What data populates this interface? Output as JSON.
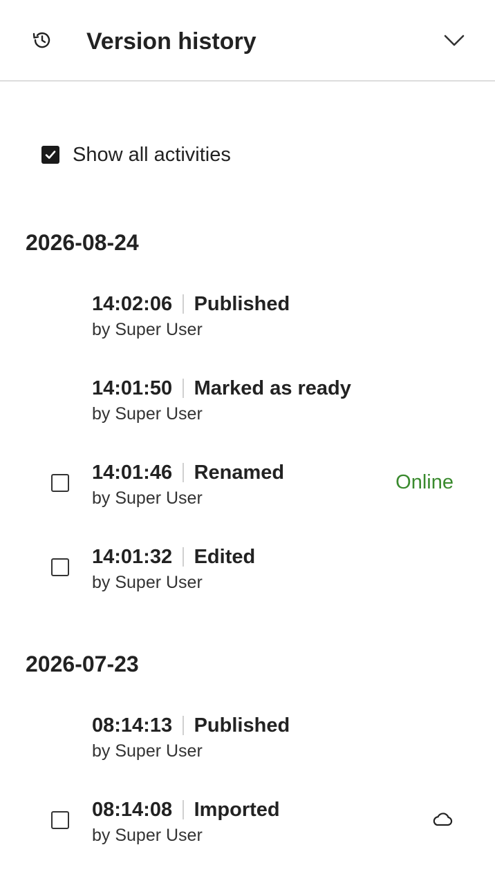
{
  "header": {
    "title": "Version history",
    "history_icon": "history-icon",
    "collapse_icon": "chevron-down-icon"
  },
  "filter": {
    "show_all_label": "Show all activities",
    "show_all_checked": true
  },
  "groups": [
    {
      "date": "2026-08-24",
      "entries": [
        {
          "time": "14:02:06",
          "action": "Published",
          "by": "by Super User",
          "selectable": false,
          "status": ""
        },
        {
          "time": "14:01:50",
          "action": "Marked as ready",
          "by": "by Super User",
          "selectable": false,
          "status": ""
        },
        {
          "time": "14:01:46",
          "action": "Renamed",
          "by": "by Super User",
          "selectable": true,
          "status": "Online"
        },
        {
          "time": "14:01:32",
          "action": "Edited",
          "by": "by Super User",
          "selectable": true,
          "status": ""
        }
      ]
    },
    {
      "date": "2026-07-23",
      "entries": [
        {
          "time": "08:14:13",
          "action": "Published",
          "by": "by Super User",
          "selectable": false,
          "status": ""
        },
        {
          "time": "08:14:08",
          "action": "Imported",
          "by": "by Super User",
          "selectable": true,
          "status": "",
          "icon": "cloud-icon"
        }
      ]
    }
  ],
  "colors": {
    "online": "#3a8a2e",
    "divider": "#dcdcdc",
    "text": "#222222"
  }
}
